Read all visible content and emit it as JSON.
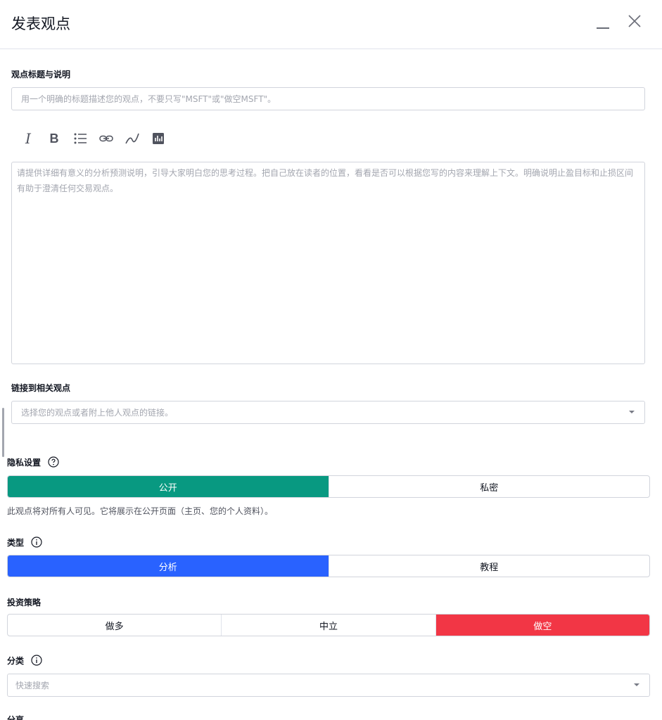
{
  "dialog": {
    "title": "发表观点"
  },
  "idea": {
    "title_label": "观点标题与说明",
    "title_placeholder": "用一个明确的标题描述您的观点，不要只写\"MSFT\"或\"做空MSFT\"。",
    "description_placeholder": "请提供详细有意义的分析预测说明，引导大家明白您的思考过程。把自己放在读者的位置，看看是否可以根据您写的内容来理解上下文。明确说明止盈目标和止损区间有助于澄清任何交易观点。"
  },
  "toolbar": {
    "italic_label": "I",
    "bold_label": "B",
    "icons": [
      "italic-icon",
      "bold-icon",
      "list-icon",
      "link-icon",
      "chart-line-icon",
      "chart-bar-icon"
    ]
  },
  "related": {
    "label": "链接到相关观点",
    "placeholder": "选择您的观点或者附上他人观点的链接。"
  },
  "privacy": {
    "label": "隐私设置",
    "options": [
      "公开",
      "私密"
    ],
    "selected": "公开",
    "description": "此观点将对所有人可见。它将展示在公开页面（主页、您的个人资料）。"
  },
  "type": {
    "label": "类型",
    "options": [
      "分析",
      "教程"
    ],
    "selected": "分析"
  },
  "strategy": {
    "label": "投资策略",
    "options": [
      "做多",
      "中立",
      "做空"
    ],
    "selected": "做空"
  },
  "category": {
    "label": "分类",
    "placeholder": "快速搜索"
  },
  "next_section": {
    "label": "分享"
  },
  "colors": {
    "public_active": "#089981",
    "analysis_active": "#2962ff",
    "short_active": "#f23645",
    "border": "#d1d4dc"
  }
}
